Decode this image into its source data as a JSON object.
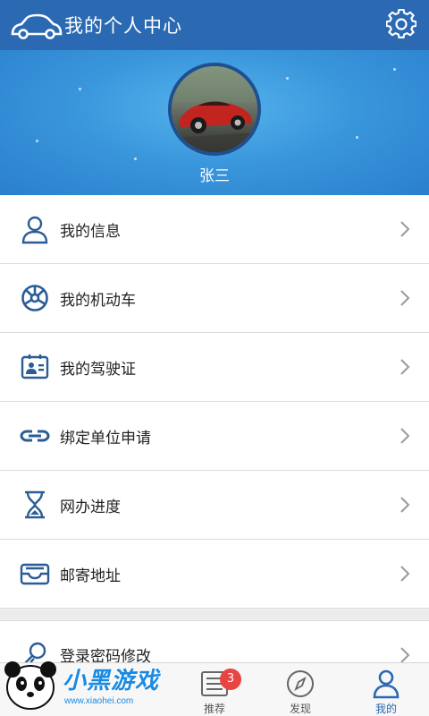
{
  "header": {
    "title": "我的个人中心",
    "logo_icon": "car-icon",
    "settings_icon": "gear-icon"
  },
  "profile": {
    "name": "张三",
    "avatar": "red-sports-car-photo"
  },
  "menu": {
    "items": [
      {
        "label": "我的信息",
        "icon": "user-icon"
      },
      {
        "label": "我的机动车",
        "icon": "steering-wheel-icon"
      },
      {
        "label": "我的驾驶证",
        "icon": "id-card-icon"
      },
      {
        "label": "绑定单位申请",
        "icon": "link-icon"
      },
      {
        "label": "网办进度",
        "icon": "hourglass-icon"
      },
      {
        "label": "邮寄地址",
        "icon": "mail-icon"
      }
    ],
    "extra": [
      {
        "label": "登录密码修改",
        "icon": "key-icon"
      }
    ]
  },
  "tabbar": {
    "tabs": [
      {
        "label": "推荐",
        "icon": "news-icon",
        "badge": "3"
      },
      {
        "label": "发现",
        "icon": "compass-icon"
      },
      {
        "label": "我的",
        "icon": "person-icon",
        "active": true
      }
    ]
  },
  "watermark": {
    "text": "小黑游戏",
    "url": "www.xiaohei.com"
  },
  "colors": {
    "primary": "#2b69b3",
    "hero": "#3a97dc",
    "badge": "#e84444"
  }
}
